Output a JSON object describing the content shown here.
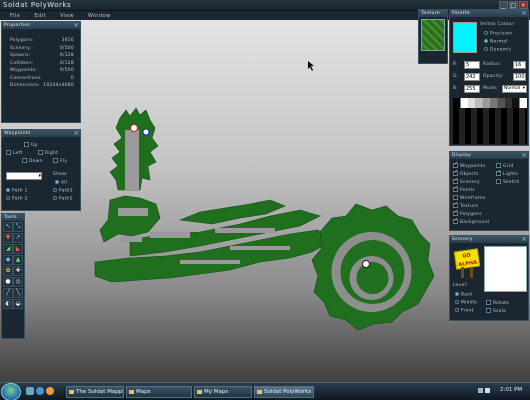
{
  "app": {
    "title": "Soldat PolyWorks"
  },
  "menu": [
    "File",
    "Edit",
    "View",
    "Window"
  ],
  "properties": {
    "header": "Properties",
    "rows": [
      {
        "label": "Polygons:",
        "value": "3816"
      },
      {
        "label": "Scenery:",
        "value": "0/500"
      },
      {
        "label": "Spawns:",
        "value": "6/128"
      },
      {
        "label": "Colliders:",
        "value": "0/128"
      },
      {
        "label": "Waypoints:",
        "value": "0/500"
      },
      {
        "label": "Connections:",
        "value": "0"
      },
      {
        "label": "Dimensions:",
        "value": "10244x4680"
      }
    ]
  },
  "waypoints": {
    "header": "Waypoints",
    "dirs": {
      "up": "Up",
      "left": "Left",
      "right": "Right",
      "down": "Down",
      "fly": "Fly"
    },
    "show_label": "Show:",
    "show_all": "All",
    "path1": "Path 1",
    "path2": "Path 2",
    "path1b": "Path1",
    "path2b": "Path2"
  },
  "tools": {
    "header": "Tools"
  },
  "texture": {
    "header": "Texture"
  },
  "palette": {
    "header": "Palette",
    "vertex_colour": "Vertex Colour:",
    "precision": "Precision",
    "normal": "Normal",
    "dynamic": "Dynamic",
    "r_label": "R:",
    "r_value": "5",
    "g_label": "G:",
    "g_value": "242",
    "b_label": "B:",
    "b_value": "255",
    "radius_label": "Radius:",
    "radius_value": "16",
    "opacity_label": "Opacity:",
    "opacity_value": "100",
    "mode_label": "Mode:",
    "mode_value": "Normal",
    "current_color": "#05f2ff"
  },
  "display": {
    "header": "Display",
    "left": [
      "Waypoints",
      "Objects",
      "Scenery",
      "Points",
      "Wireframe",
      "Texture",
      "Polygons",
      "Background"
    ],
    "left_checked": [
      true,
      true,
      true,
      true,
      false,
      true,
      true,
      true
    ],
    "right": [
      "Grid",
      "Lights",
      "Sketch"
    ],
    "right_checked": [
      false,
      true,
      false
    ]
  },
  "scenery": {
    "header": "Scenery",
    "sign_text": "GO ALPHA",
    "level_label": "Level:",
    "back": "Back",
    "middle": "Middle",
    "front": "Front",
    "rotate": "Rotate",
    "scale": "Scale"
  },
  "taskbar": {
    "buttons": [
      "The Soldat Mapping...",
      "Maps",
      "My Maps",
      "Soldat PolyWorks"
    ],
    "clock": "2:01 PM"
  },
  "colors": {
    "map_green": "#1f7a1f",
    "panel_bg": "#1b2730",
    "accent": "#6ee6e0"
  }
}
